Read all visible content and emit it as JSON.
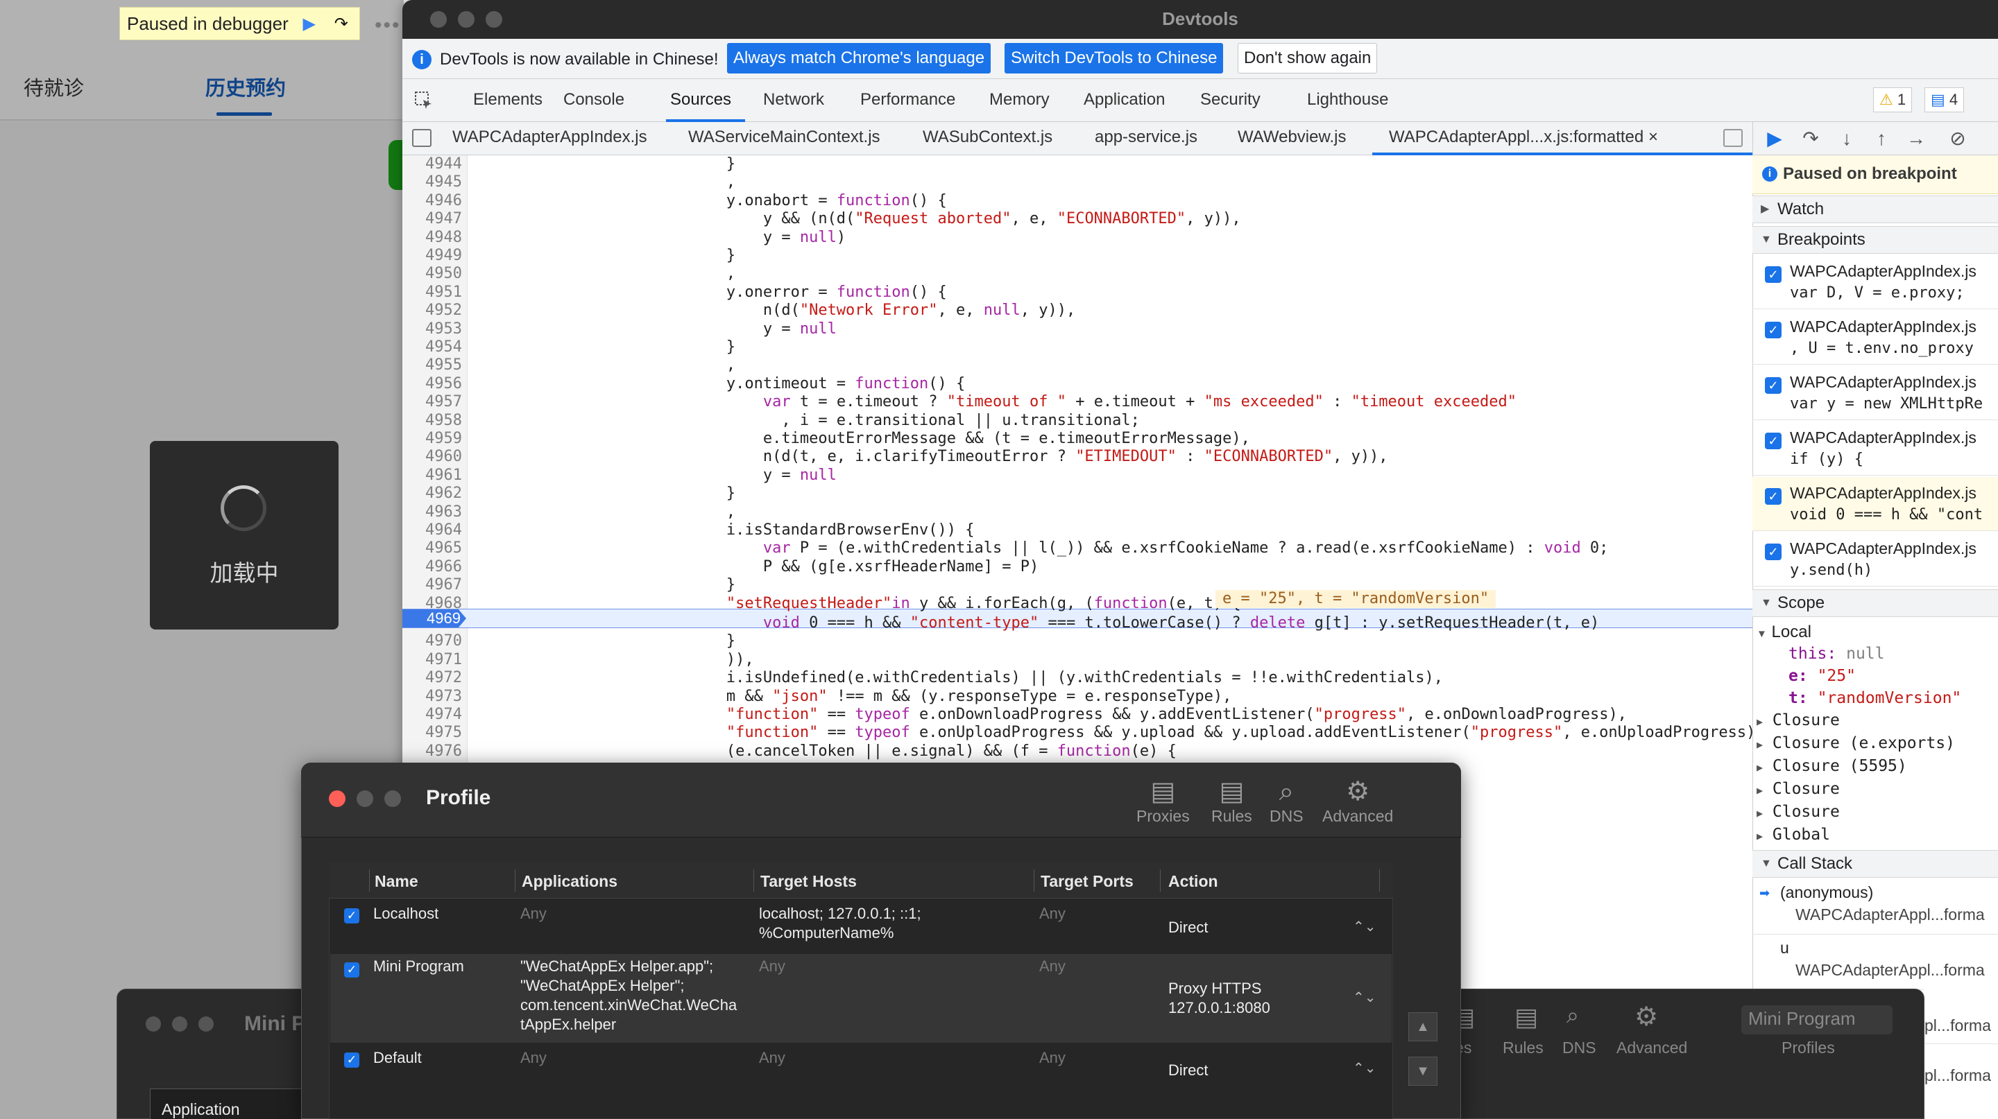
{
  "miniapp": {
    "debug_banner": "Paused in debugger",
    "tabs": [
      "待就诊",
      "历史预约"
    ],
    "loading_text": "加载中"
  },
  "devtools": {
    "window_title": "Devtools",
    "infobar": {
      "message": "DevTools is now available in Chinese!",
      "btn_match": "Always match Chrome's language",
      "btn_switch": "Switch DevTools to Chinese",
      "btn_dont": "Don't show again"
    },
    "panel_tabs": [
      "Elements",
      "Console",
      "Sources",
      "Network",
      "Performance",
      "Memory",
      "Application",
      "Security",
      "Lighthouse"
    ],
    "active_panel": "Sources",
    "warnings": "1",
    "messages": "4",
    "file_tabs": [
      "WAPCAdapterAppIndex.js",
      "WAServiceMainContext.js",
      "WASubContext.js",
      "app-service.js",
      "WAWebview.js",
      "WAPCAdapterAppl...x.js:formatted"
    ],
    "close_glyph": "×",
    "current_line": "4969",
    "inline_value": "e = \"25\", t = \"randomVersion\"",
    "code_lines": [
      {
        "n": "4944",
        "segs": [
          [
            "f",
            "                            }"
          ]
        ]
      },
      {
        "n": "4945",
        "segs": [
          [
            "f",
            "                            ,"
          ]
        ]
      },
      {
        "n": "4946",
        "segs": [
          [
            "f",
            "                            y.onabort = "
          ],
          [
            "k",
            "function"
          ],
          [
            "f",
            "() {"
          ]
        ]
      },
      {
        "n": "4947",
        "segs": [
          [
            "f",
            "                                y && (n(d("
          ],
          [
            "s",
            "\"Request aborted\""
          ],
          [
            "f",
            ", e, "
          ],
          [
            "s",
            "\"ECONNABORTED\""
          ],
          [
            "f",
            ", y)),"
          ]
        ]
      },
      {
        "n": "4948",
        "segs": [
          [
            "f",
            "                                y = "
          ],
          [
            "k",
            "null"
          ],
          [
            "f",
            ")"
          ]
        ]
      },
      {
        "n": "4949",
        "segs": [
          [
            "f",
            "                            }"
          ]
        ]
      },
      {
        "n": "4950",
        "segs": [
          [
            "f",
            "                            ,"
          ]
        ]
      },
      {
        "n": "4951",
        "segs": [
          [
            "f",
            "                            y.onerror = "
          ],
          [
            "k",
            "function"
          ],
          [
            "f",
            "() {"
          ]
        ]
      },
      {
        "n": "4952",
        "segs": [
          [
            "f",
            "                                n(d("
          ],
          [
            "s",
            "\"Network Error\""
          ],
          [
            "f",
            ", e, "
          ],
          [
            "k",
            "null"
          ],
          [
            "f",
            ", y)),"
          ]
        ]
      },
      {
        "n": "4953",
        "segs": [
          [
            "f",
            "                                y = "
          ],
          [
            "k",
            "null"
          ]
        ]
      },
      {
        "n": "4954",
        "segs": [
          [
            "f",
            "                            }"
          ]
        ]
      },
      {
        "n": "4955",
        "segs": [
          [
            "f",
            "                            ,"
          ]
        ]
      },
      {
        "n": "4956",
        "segs": [
          [
            "f",
            "                            y.ontimeout = "
          ],
          [
            "k",
            "function"
          ],
          [
            "f",
            "() {"
          ]
        ]
      },
      {
        "n": "4957",
        "segs": [
          [
            "f",
            "                                "
          ],
          [
            "k",
            "var"
          ],
          [
            "f",
            " t = e.timeout ? "
          ],
          [
            "s",
            "\"timeout of \""
          ],
          [
            "f",
            " + e.timeout + "
          ],
          [
            "s",
            "\"ms exceeded\""
          ],
          [
            "f",
            " : "
          ],
          [
            "s",
            "\"timeout exceeded\""
          ]
        ]
      },
      {
        "n": "4958",
        "segs": [
          [
            "f",
            "                                  , i = e.transitional || u.transitional;"
          ]
        ]
      },
      {
        "n": "4959",
        "segs": [
          [
            "f",
            "                                e.timeoutErrorMessage && (t = e.timeoutErrorMessage),"
          ]
        ]
      },
      {
        "n": "4960",
        "segs": [
          [
            "f",
            "                                n(d(t, e, i.clarifyTimeoutError ? "
          ],
          [
            "s",
            "\"ETIMEDOUT\""
          ],
          [
            "f",
            " : "
          ],
          [
            "s",
            "\"ECONNABORTED\""
          ],
          [
            "f",
            ", y)),"
          ]
        ]
      },
      {
        "n": "4961",
        "segs": [
          [
            "f",
            "                                y = "
          ],
          [
            "k",
            "null"
          ]
        ]
      },
      {
        "n": "4962",
        "segs": [
          [
            "f",
            "                            }"
          ]
        ]
      },
      {
        "n": "4963",
        "segs": [
          [
            "f",
            "                            ,"
          ]
        ]
      },
      {
        "n": "4964",
        "segs": [
          [
            "f",
            "                            i.isStandardBrowserEnv()) {"
          ]
        ]
      },
      {
        "n": "4965",
        "segs": [
          [
            "f",
            "                                "
          ],
          [
            "k",
            "var"
          ],
          [
            "f",
            " P = (e.withCredentials || l(_)) && e.xsrfCookieName ? a.read(e.xsrfCookieName) : "
          ],
          [
            "k",
            "void"
          ],
          [
            "f",
            " 0;"
          ]
        ]
      },
      {
        "n": "4966",
        "segs": [
          [
            "f",
            "                                P && (g[e.xsrfHeaderName] = P)"
          ]
        ]
      },
      {
        "n": "4967",
        "segs": [
          [
            "f",
            "                            }"
          ]
        ]
      },
      {
        "n": "4968",
        "segs": [
          [
            "s",
            "                            \"setRequestHeader\""
          ],
          [
            "k",
            "in"
          ],
          [
            "f",
            " y && i.forEach(g, ("
          ],
          [
            "k",
            "function"
          ],
          [
            "f",
            "(e, t) {"
          ]
        ]
      },
      {
        "n": "4969",
        "segs": [
          [
            "f",
            "                                "
          ],
          [
            "k",
            "void"
          ],
          [
            "f",
            " 0 === h && "
          ],
          [
            "s",
            "\"content-type\""
          ],
          [
            "f",
            " === t.toLowerCase() ? "
          ],
          [
            "k",
            "delete"
          ],
          [
            "f",
            " g[t] : y.setRequestHeader(t, e)"
          ]
        ]
      },
      {
        "n": "4970",
        "segs": [
          [
            "f",
            "                            }"
          ]
        ]
      },
      {
        "n": "4971",
        "segs": [
          [
            "f",
            "                            )),"
          ]
        ]
      },
      {
        "n": "4972",
        "segs": [
          [
            "f",
            "                            i.isUndefined(e.withCredentials) || (y.withCredentials = !!e.withCredentials),"
          ]
        ]
      },
      {
        "n": "4973",
        "segs": [
          [
            "f",
            "                            m && "
          ],
          [
            "s",
            "\"json\""
          ],
          [
            "f",
            " !== m && (y.responseType = e.responseType),"
          ]
        ]
      },
      {
        "n": "4974",
        "segs": [
          [
            "s",
            "                            \"function\""
          ],
          [
            "f",
            " == "
          ],
          [
            "k",
            "typeof"
          ],
          [
            "f",
            " e.onDownloadProgress && y.addEventListener("
          ],
          [
            "s",
            "\"progress\""
          ],
          [
            "f",
            ", e.onDownloadProgress),"
          ]
        ]
      },
      {
        "n": "4975",
        "segs": [
          [
            "s",
            "                            \"function\""
          ],
          [
            "f",
            " == "
          ],
          [
            "k",
            "typeof"
          ],
          [
            "f",
            " e.onUploadProgress && y.upload && y.upload.addEventListener("
          ],
          [
            "s",
            "\"progress\""
          ],
          [
            "f",
            ", e.onUploadProgress),"
          ]
        ]
      },
      {
        "n": "4976",
        "segs": [
          [
            "f",
            "                            (e.cancelToken || e.signal) && (f = "
          ],
          [
            "k",
            "function"
          ],
          [
            "f",
            "(e) {"
          ]
        ]
      }
    ],
    "sidebar": {
      "paused": "Paused on breakpoint",
      "watch": "Watch",
      "breakpoints_label": "Breakpoints",
      "breakpoints": [
        {
          "file": "WAPCAdapterAppIndex.js",
          "code": "var D, V = e.proxy;"
        },
        {
          "file": "WAPCAdapterAppIndex.js",
          "code": ", U = t.env.no_proxy"
        },
        {
          "file": "WAPCAdapterAppIndex.js",
          "code": "var y = new XMLHttpRe"
        },
        {
          "file": "WAPCAdapterAppIndex.js",
          "code": "if (y) {"
        },
        {
          "file": "WAPCAdapterAppIndex.js",
          "code": "void 0 === h && \"cont"
        },
        {
          "file": "WAPCAdapterAppIndex.js",
          "code": "y.send(h)"
        }
      ],
      "scope_label": "Scope",
      "local_label": "Local",
      "this_key": "this:",
      "this_val": "null",
      "e_key": "e:",
      "e_val": "\"25\"",
      "t_key": "t:",
      "t_val": "\"randomVersion\"",
      "closures": [
        "Closure",
        "Closure (e.exports)",
        "Closure (5595)",
        "Closure",
        "Closure",
        "Global"
      ],
      "callstack_label": "Call Stack",
      "callstack": [
        {
          "fn": "(anonymous)",
          "loc": "WAPCAdapterAppl...forma"
        },
        {
          "fn": "u",
          "loc": "WAPCAdapterAppl...forma"
        },
        {
          "fn": "",
          "loc": "pl...forma"
        },
        {
          "fn": "",
          "loc": "pl...forma"
        }
      ]
    }
  },
  "profile": {
    "title": "Profile",
    "toolbar": [
      "Proxies",
      "Rules",
      "DNS",
      "Advanced"
    ],
    "columns": [
      "Name",
      "Applications",
      "Target Hosts",
      "Target Ports",
      "Action"
    ],
    "rows": [
      {
        "name": "Localhost",
        "apps": [
          "Any"
        ],
        "hosts": [
          "localhost; 127.0.0.1; ::1;",
          "%ComputerName%"
        ],
        "ports": "Any",
        "action": [
          "Direct"
        ]
      },
      {
        "name": "Mini Program",
        "apps": [
          "\"WeChatAppEx Helper.app\";",
          "\"WeChatAppEx Helper\";",
          "com.tencent.xinWeChat.WeCha",
          "tAppEx.helper"
        ],
        "hosts": [
          "Any"
        ],
        "ports": "Any",
        "action": [
          "Proxy HTTPS",
          "127.0.0.1:8080"
        ]
      },
      {
        "name": "Default",
        "apps": [
          "Any"
        ],
        "hosts": [
          "Any"
        ],
        "ports": "Any",
        "action": [
          "Direct"
        ]
      }
    ]
  },
  "back_window": {
    "title": "Mini P",
    "app_tab": "Application",
    "toolbar": [
      "ies",
      "Rules",
      "DNS",
      "Advanced"
    ],
    "select": "Mini Program",
    "profiles": "Profiles"
  }
}
